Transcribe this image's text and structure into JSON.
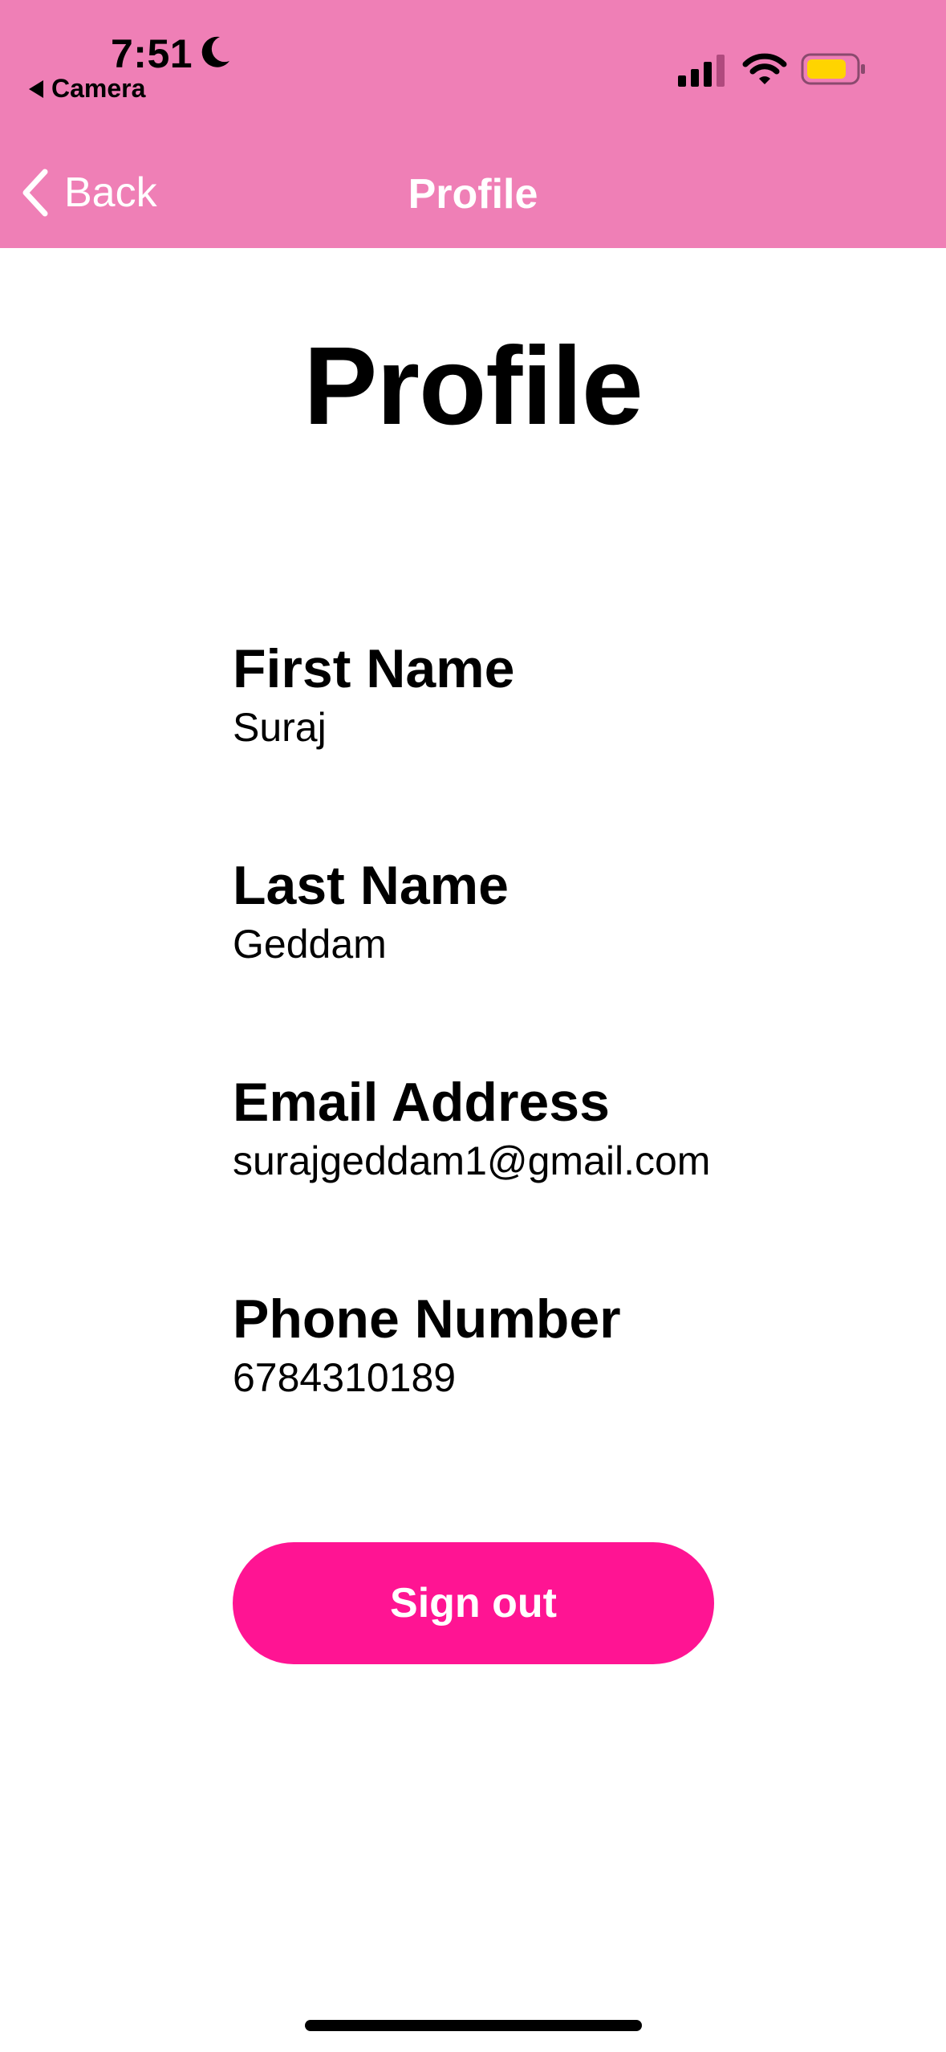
{
  "status_bar": {
    "time": "7:51",
    "back_app": "Camera"
  },
  "nav": {
    "back_label": "Back",
    "title": "Profile"
  },
  "page": {
    "title": "Profile"
  },
  "fields": [
    {
      "label": "First Name",
      "value": "Suraj"
    },
    {
      "label": "Last Name",
      "value": "Geddam"
    },
    {
      "label": "Email Address",
      "value": "surajgeddam1@gmail.com"
    },
    {
      "label": "Phone Number",
      "value": "6784310189"
    }
  ],
  "actions": {
    "sign_out_label": "Sign out"
  },
  "colors": {
    "header": "#EF7FB6",
    "sign_out_button": "#FF1493",
    "battery_fill": "#FFD400"
  },
  "icons": {
    "moon": "moon-icon",
    "signal": "cellular-signal-icon",
    "wifi": "wifi-icon",
    "battery": "battery-icon",
    "back": "chevron-left-icon",
    "camera_back": "triangle-left-icon"
  }
}
